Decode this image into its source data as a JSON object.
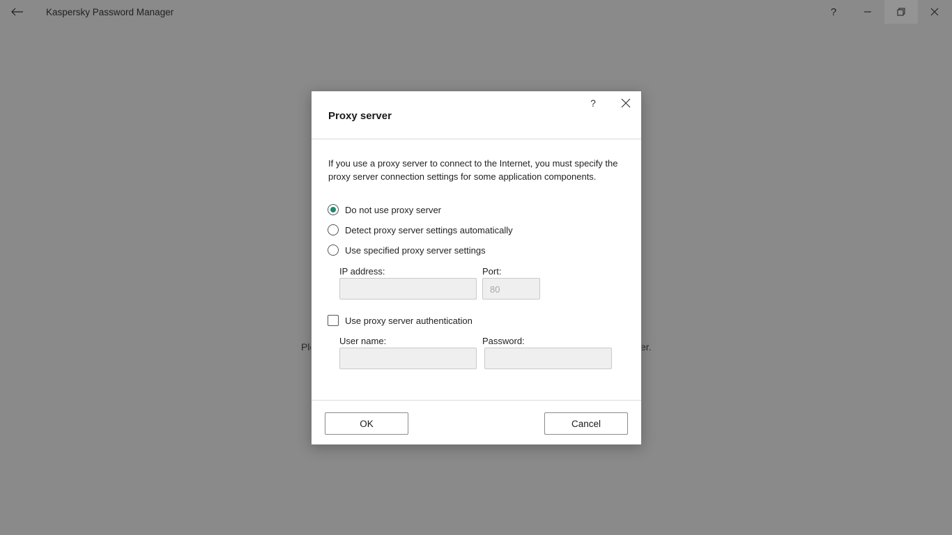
{
  "window": {
    "title": "Kaspersky Password Manager",
    "help_glyph": "?",
    "back_icon": "back-arrow-icon",
    "minimize_icon": "minimize-icon",
    "restore_icon": "restore-icon",
    "close_icon": "close-icon"
  },
  "background": {
    "text_left_fragment": "Ple",
    "text_right_fragment": "er."
  },
  "dialog": {
    "title": "Proxy server",
    "help_glyph": "?",
    "description": "If you use a proxy server to connect to the Internet, you must specify the proxy server connection settings for some application components.",
    "options": [
      {
        "label": "Do not use proxy server",
        "checked": true
      },
      {
        "label": "Detect proxy server settings automatically",
        "checked": false
      },
      {
        "label": "Use specified proxy server settings",
        "checked": false
      }
    ],
    "ip_label": "IP address:",
    "ip_value": "",
    "port_label": "Port:",
    "port_value": "80",
    "auth_checkbox_label": "Use proxy server authentication",
    "auth_checked": false,
    "username_label": "User name:",
    "username_value": "",
    "password_label": "Password:",
    "password_value": "",
    "ok_label": "OK",
    "cancel_label": "Cancel",
    "accent_color": "#1e8a6e"
  }
}
